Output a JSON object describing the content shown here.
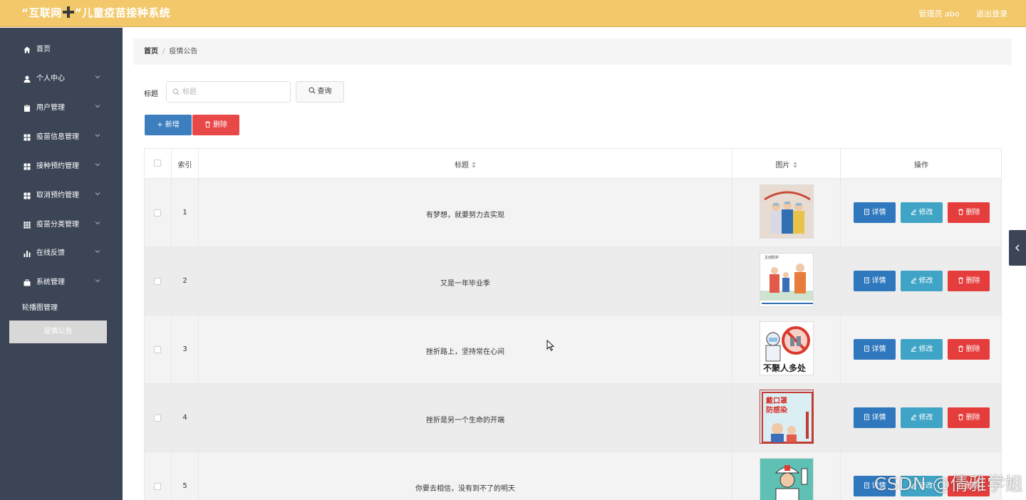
{
  "header": {
    "title_part1": "“互联网",
    "title_part2": "”儿童疫苗接种系统",
    "user_label": "管理员 abo",
    "logout": "退出登录"
  },
  "sidebar": {
    "items": [
      {
        "label": "首页",
        "icon": "home-icon",
        "expandable": false
      },
      {
        "label": "个人中心",
        "icon": "user-icon",
        "expandable": true
      },
      {
        "label": "用户管理",
        "icon": "clipboard-icon",
        "expandable": true
      },
      {
        "label": "疫苗信息管理",
        "icon": "grid-icon",
        "expandable": true
      },
      {
        "label": "接种预约管理",
        "icon": "grid-icon",
        "expandable": true
      },
      {
        "label": "取消预约管理",
        "icon": "grid-icon",
        "expandable": true
      },
      {
        "label": "疫苗分类管理",
        "icon": "apps-icon",
        "expandable": true
      },
      {
        "label": "在线反馈",
        "icon": "bar-chart-icon",
        "expandable": true
      },
      {
        "label": "系统管理",
        "icon": "suitcase-icon",
        "expandable": true
      }
    ],
    "sub_items": [
      {
        "label": "轮播图管理",
        "active": false
      },
      {
        "label": "疫情公告",
        "active": true
      }
    ]
  },
  "breadcrumb": {
    "home": "首页",
    "separator": "/",
    "current": "疫情公告"
  },
  "search": {
    "label": "标题",
    "placeholder": "标题",
    "value": "",
    "query_button": "查询"
  },
  "toolbar": {
    "add": "新增",
    "delete": "删除"
  },
  "table": {
    "headers": {
      "index": "索引",
      "title": "标题",
      "image": "图片",
      "actions": "操作"
    },
    "rows": [
      {
        "index": "1",
        "title": "有梦想，就要努力去实现"
      },
      {
        "index": "2",
        "title": "又是一年毕业季"
      },
      {
        "index": "3",
        "title": "挫折路上，坚持常在心间"
      },
      {
        "index": "4",
        "title": "挫折是另一个生命的开端"
      },
      {
        "index": "5",
        "title": "你要去相信，没有到不了的明天"
      }
    ],
    "row_actions": {
      "detail": "详情",
      "edit": "修改",
      "remove": "删除"
    },
    "thumb_texts": {
      "t2": "主动防护",
      "t3": "不聚人多处",
      "t4a": "戴口罩",
      "t4b": "防感染"
    }
  },
  "watermark": "CSDN @倩雅学姐",
  "colors": {
    "topbar": "#f2c86a",
    "sidebar": "#3c4556",
    "primary": "#3d7ebf",
    "info": "#3fa4c6",
    "danger": "#e84948"
  }
}
